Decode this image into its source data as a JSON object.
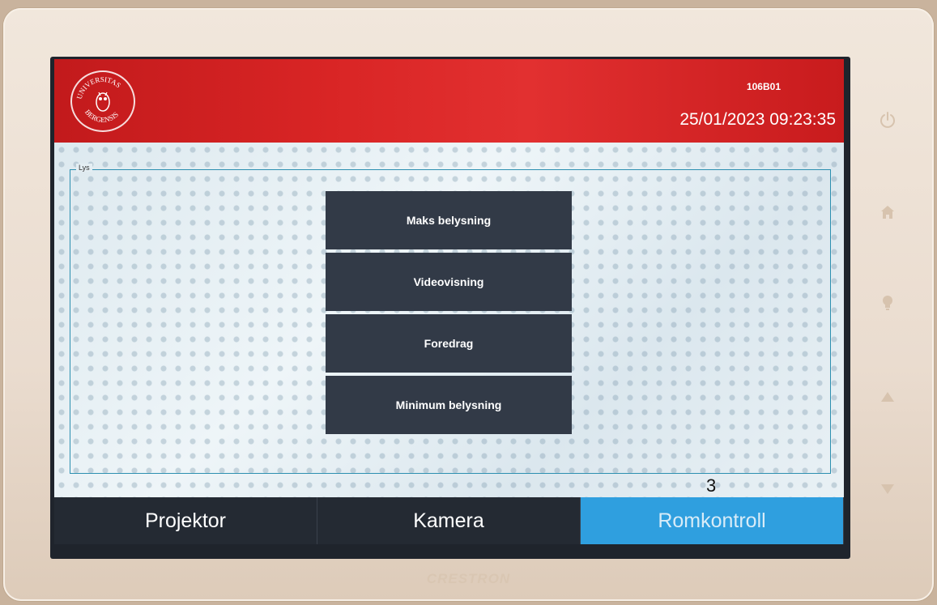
{
  "header": {
    "room_id": "106B01",
    "datetime": "25/01/2023 09:23:35",
    "logo_text_top": "UNIVERSITAS",
    "logo_text_bottom": "BERGENSIS"
  },
  "lighting": {
    "group_label": "Lys",
    "presets": [
      {
        "label": "Maks belysning"
      },
      {
        "label": "Videovisning"
      },
      {
        "label": "Foredrag"
      },
      {
        "label": "Minimum belysning"
      }
    ]
  },
  "annotation": {
    "number": "3"
  },
  "tabs": [
    {
      "label": "Projektor",
      "active": false
    },
    {
      "label": "Kamera",
      "active": false
    },
    {
      "label": "Romkontroll",
      "active": true
    }
  ],
  "device": {
    "brand": "CRESTRON"
  },
  "side_buttons": [
    "power-icon",
    "home-icon",
    "lightbulb-icon",
    "arrow-up-icon",
    "arrow-down-icon"
  ],
  "colors": {
    "header_red": "#d92525",
    "button_dark": "#323a47",
    "tab_active": "#2f9fdf",
    "tab_inactive": "#242a33"
  }
}
